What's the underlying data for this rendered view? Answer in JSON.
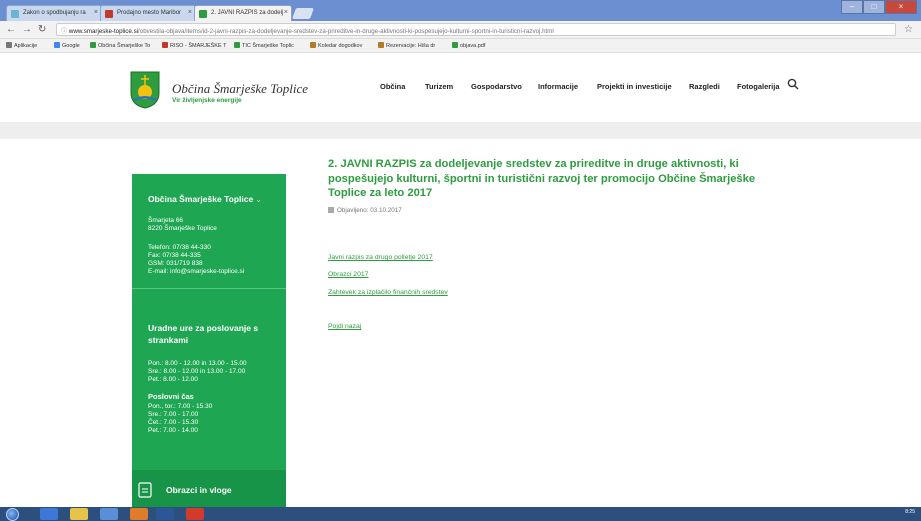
{
  "browser": {
    "tabs": [
      {
        "label": "Zakon o spodbujanju ra",
        "color": "#6cb3d8"
      },
      {
        "label": "Prodajno mesto Maribor",
        "color": "#c0392b"
      },
      {
        "label": "2. JAVNI RAZPIS za dodelj",
        "color": "#2e9c3f"
      }
    ],
    "url_host": "www.smarjeske-toplice.si",
    "url_path": "/obvestila-objava/items/id-2-javni-razpis-za-dodeljevanje-sredstev-za-prireditve-in-druge-aktivnosti-ki-pospesujejo-kulturni-sportni-in-turisticni-razvoj.html",
    "bookmarks": [
      {
        "label": "Aplikacije",
        "color": "#777"
      },
      {
        "label": "Google",
        "color": "#4285f4"
      },
      {
        "label": "Občina Šmarješke To",
        "color": "#2e9c3f"
      },
      {
        "label": "RISO - ŠMARJEŠKE T",
        "color": "#c0392b"
      },
      {
        "label": "TIC Šmarješke Toplic",
        "color": "#2e9c3f"
      },
      {
        "label": "Koledar dogodkov",
        "color": "#b07b2a"
      },
      {
        "label": "Rezervacije: Hiša dr",
        "color": "#b07b2a"
      },
      {
        "label": "objava.pdf",
        "color": "#2e9c3f"
      }
    ]
  },
  "site": {
    "title": "Občina Šmarješke Toplice",
    "tagline": "Vir življenjske energije",
    "nav": [
      "Občina",
      "Turizem",
      "Gospodarstvo",
      "Informacije",
      "Projekti in investicije",
      "Razgledi",
      "Fotogalerija"
    ]
  },
  "sidebar": {
    "municipality_heading": "Občina Šmarješke Toplice",
    "address_1": "Šmarjeta 66",
    "address_2": "8220 Šmarješke Toplice",
    "phone": "Telefon: 07/38 44-330",
    "fax": "Fax: 07/38 44-335",
    "gsm": "GSM: 031/719 838",
    "email": "E-mail: info@smarjeske-toplice.si",
    "hours_heading_1": "Uradne ure za poslovanje s",
    "hours_heading_2": "strankami",
    "hours_1": "Pon.: 8.00 - 12.00 in 13.00 - 15.00",
    "hours_2": "Sre.: 8.00 - 12.00 in 13.00 - 17.00",
    "hours_3": "Pet.: 8.00 - 12.00",
    "business_heading": "Poslovni čas",
    "business_1": "Pon., tor.: 7.00 - 15.30",
    "business_2": "Sre.: 7.00 - 17.00",
    "business_3": "Čet.: 7.00 - 15.30",
    "business_4": "Pet.: 7.00 - 14.00",
    "forms_label": "Obrazci in vloge"
  },
  "article": {
    "title": "2. JAVNI RAZPIS za dodeljevanje sredstev za prireditve in druge aktivnosti, ki pospešujejo kulturni, športni in turistični razvoj ter promocijo Občine Šmarješke Toplice za leto 2017",
    "published": "Objavljeno: 03.10.2017",
    "links": [
      "Javni razpis za drugo polletje 2017",
      "Obrazci 2017",
      "Zahtevek za izplačilo finančnih sredstev"
    ],
    "back": "Pojdi nazaj"
  },
  "taskbar": {
    "tray_time": "8:25"
  }
}
